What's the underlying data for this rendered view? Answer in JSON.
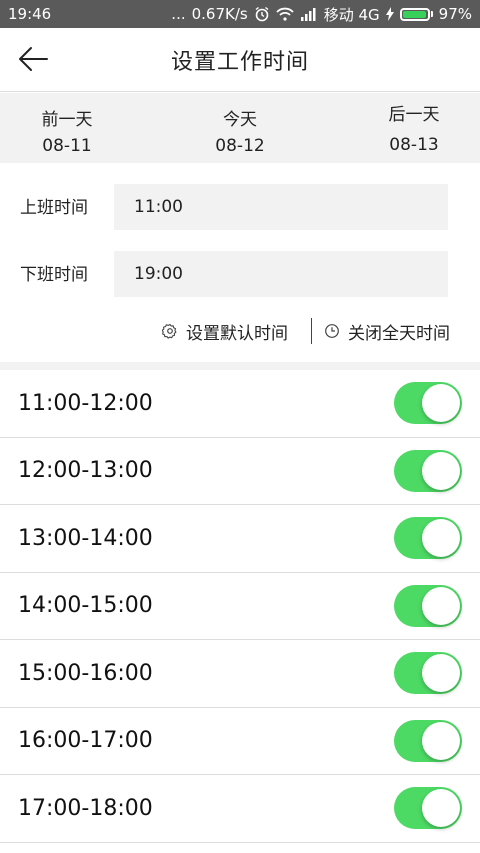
{
  "status_bar": {
    "time": "19:46",
    "dots": "...",
    "speed": "0.67K/s",
    "carrier": "移动 4G",
    "battery_percent": "97%",
    "battery_level": 0.97,
    "battery_color": "#36d05a"
  },
  "header": {
    "title": "设置工作时间",
    "back_icon": "arrow-left-icon"
  },
  "days": {
    "prev": {
      "name": "前一天",
      "date": "08-11"
    },
    "today": {
      "name": "今天",
      "date": "08-12"
    },
    "next": {
      "name": "后一天",
      "date": "08-13"
    }
  },
  "work_time": {
    "start_label": "上班时间",
    "start_value": "11:00",
    "end_label": "下班时间",
    "end_value": "19:00"
  },
  "actions": {
    "set_default_label": "设置默认时间",
    "set_default_icon": "gear-icon",
    "close_all_label": "关闭全天时间",
    "close_all_icon": "clock-icon"
  },
  "slots": [
    {
      "label": "11:00-12:00",
      "on": true
    },
    {
      "label": "12:00-13:00",
      "on": true
    },
    {
      "label": "13:00-14:00",
      "on": true
    },
    {
      "label": "14:00-15:00",
      "on": true
    },
    {
      "label": "15:00-16:00",
      "on": true
    },
    {
      "label": "16:00-17:00",
      "on": true
    },
    {
      "label": "17:00-18:00",
      "on": true
    }
  ],
  "colors": {
    "switch_on": "#4cd964",
    "panel_bg": "#f2f2f2"
  }
}
